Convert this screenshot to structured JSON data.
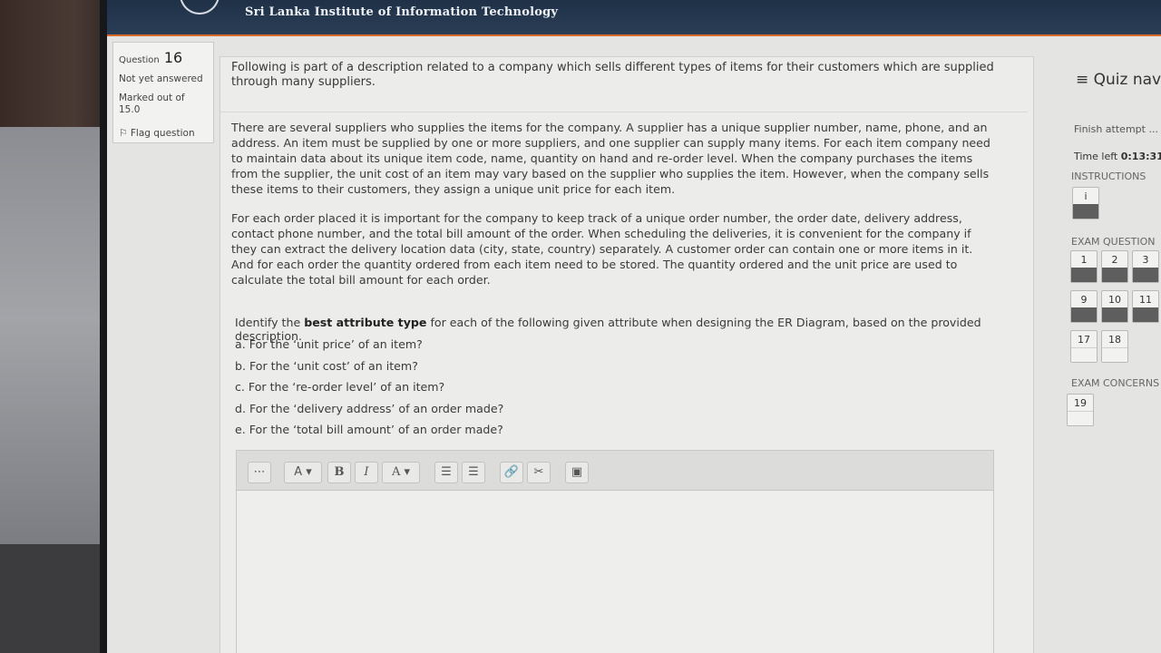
{
  "header": {
    "org_name": "Sri Lanka Institute of Information Technology"
  },
  "question_info": {
    "label": "Question",
    "number": "16",
    "status": "Not yet answered",
    "marks": "Marked out of 15.0",
    "flag_label": "Flag question"
  },
  "question": {
    "intro": "Following is part of a description related to a company which sells different types of items for their customers which are supplied through many suppliers.",
    "paragraph1": "There are several suppliers who supplies the items for the company. A supplier has a unique supplier number, name, phone, and an address. An item must be supplied by one or more suppliers, and one supplier can supply many items. For each item company need to maintain data about its unique item code, name, quantity on hand and re-order level. When the company purchases the items from the supplier, the unit cost of an item may vary based on the supplier who supplies the item. However, when the company sells these items to their customers, they assign a unique unit price for each item.",
    "paragraph2": "For each order placed it is important for the company to keep track of a unique order number, the order date, delivery address, contact phone number, and the total bill amount of the order. When scheduling the deliveries, it is convenient for the company if they can extract the delivery location data (city, state, country) separately. A customer order can contain one or more items in it. And for each order the quantity ordered from each item need to be stored. The quantity ordered and the unit price are used to calculate the total bill amount for each order.",
    "prompt_start": "Identify the ",
    "prompt_bold": "best attribute type",
    "prompt_end": " for each of the following given attribute when designing the ER Diagram, based on the provided description.",
    "sub_a": "a. For the ‘unit price’ of an item?",
    "sub_b": "b. For the ‘unit cost’ of an item?",
    "sub_c": "c. For the ‘re-order level’ of an item?",
    "sub_d": "d. For the ‘delivery address’ of an order made?",
    "sub_e": "e. For the ‘total bill amount’ of an order made?"
  },
  "editor": {
    "toolbar": {
      "collapse": "⋯",
      "styles": "A",
      "bold": "B",
      "italic": "I",
      "font_color": "A",
      "unordered_list": "☰",
      "ordered_list": "☰",
      "link": "🔗",
      "unlink": "✂",
      "image": "▣"
    }
  },
  "nav": {
    "title": "≡ Quiz nav",
    "finish_attempt": "Finish attempt ...",
    "time_left_label": "Time left ",
    "time_left_value": "0:13:31",
    "instructions_label": "INSTRUCTIONS",
    "instructions_button": "i",
    "exam_questions_label": "EXAM QUESTION",
    "exam_buttons_row1": [
      "1",
      "2",
      "3"
    ],
    "exam_buttons_row2": [
      "9",
      "10",
      "11"
    ],
    "exam_buttons_row3": [
      "17",
      "18"
    ],
    "exam_concerns_label": "EXAM CONCERNS",
    "concerns_button": "19"
  }
}
